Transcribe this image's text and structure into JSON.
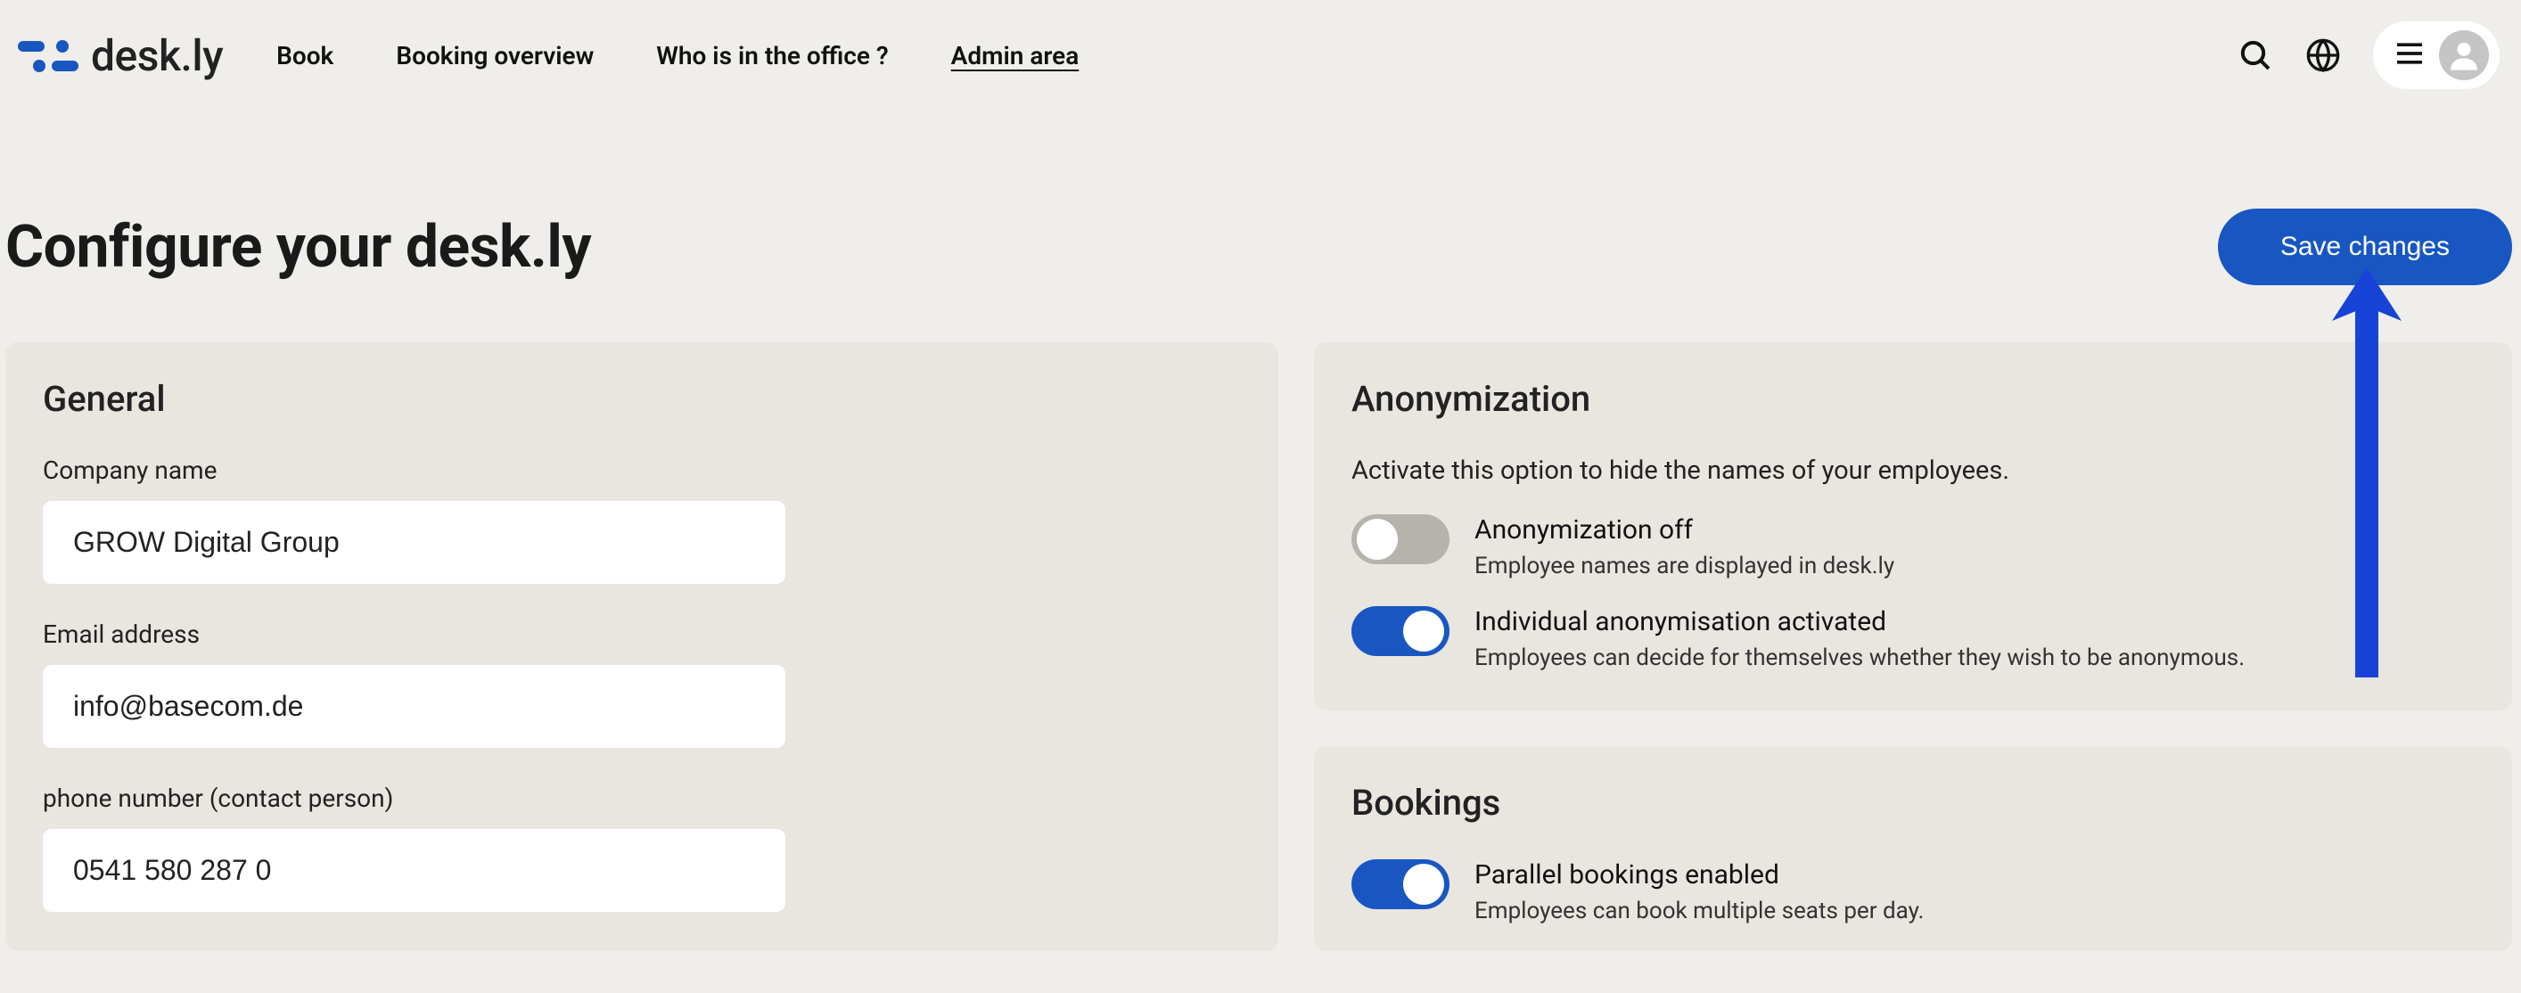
{
  "header": {
    "logo_text": "desk.ly",
    "nav": [
      {
        "label": "Book",
        "active": false
      },
      {
        "label": "Booking overview",
        "active": false
      },
      {
        "label": "Who is in the office ?",
        "active": false
      },
      {
        "label": "Admin area",
        "active": true
      }
    ]
  },
  "page": {
    "title": "Configure your desk.ly",
    "save_label": "Save changes"
  },
  "general": {
    "heading": "General",
    "company_label": "Company name",
    "company_value": "GROW Digital Group",
    "email_label": "Email address",
    "email_value": "info@basecom.de",
    "phone_label": "phone number (contact person)",
    "phone_value": "0541 580 287 0"
  },
  "anonymization": {
    "heading": "Anonymization",
    "intro": "Activate this option to hide the names of your employees.",
    "rows": [
      {
        "title": "Anonymization off",
        "sub": "Employee names are displayed in desk.ly",
        "on": false
      },
      {
        "title": "Individual anonymisation activated",
        "sub": "Employees can decide for themselves whether they wish to be anonymous.",
        "on": true
      }
    ]
  },
  "bookings": {
    "heading": "Bookings",
    "rows": [
      {
        "title": "Parallel bookings enabled",
        "sub": "Employees can book multiple seats per day.",
        "on": true
      }
    ]
  },
  "colors": {
    "primary": "#1857c2",
    "card_bg": "#e9e6df",
    "page_bg": "#f0eeea"
  }
}
